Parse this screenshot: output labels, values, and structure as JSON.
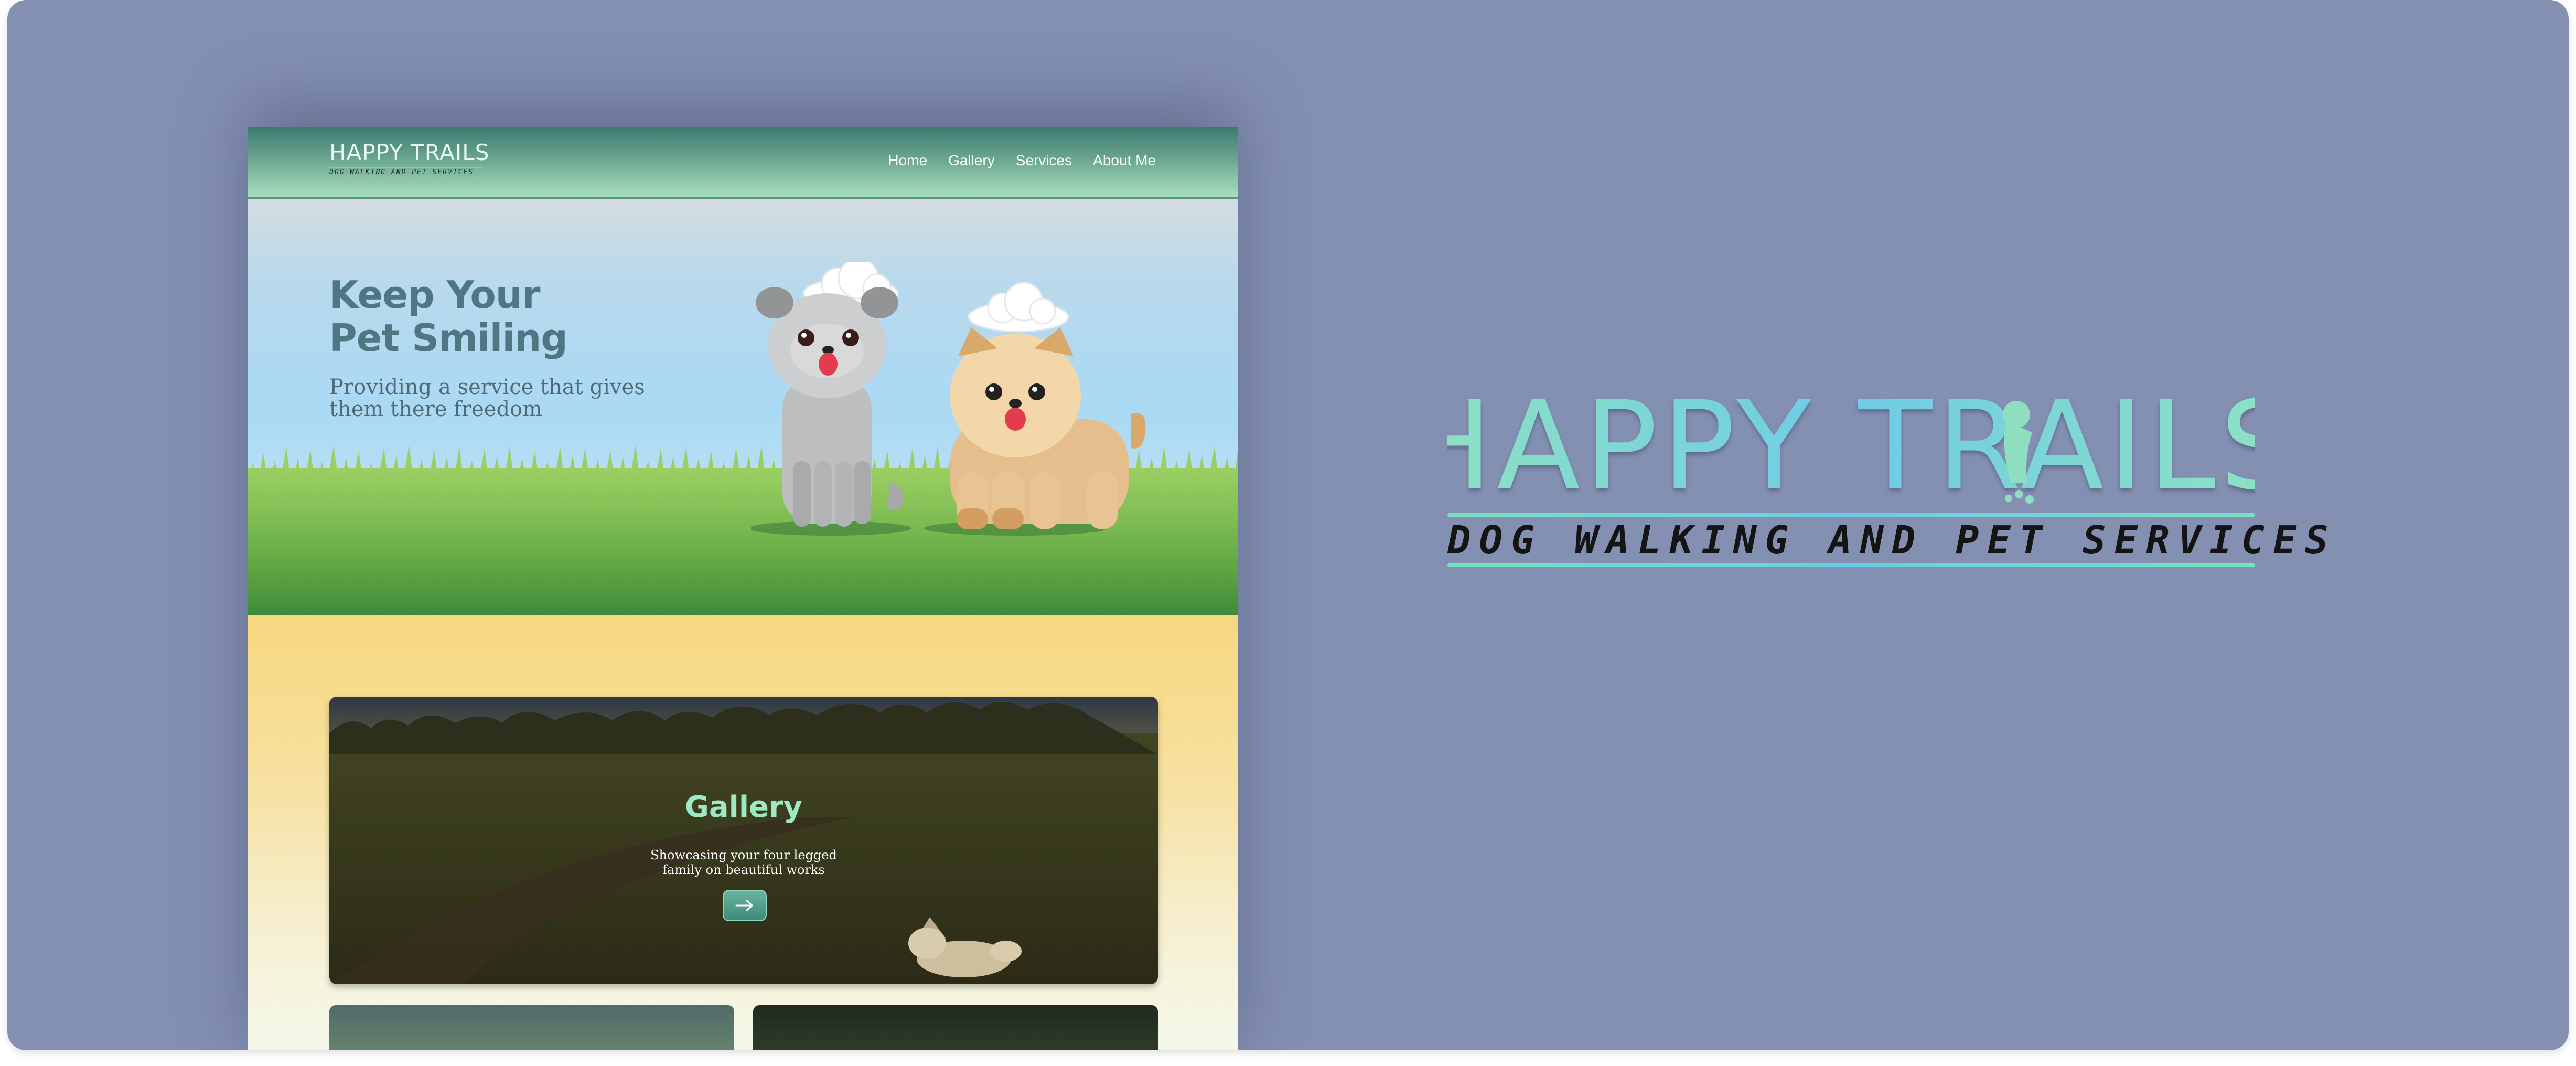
{
  "brand": {
    "name": "HAPPY TRAILS",
    "tagline": "DOG WALKING AND PET SERVICES",
    "colors": {
      "mint": "#8fe3c0",
      "sky": "#6ecbe6",
      "teal": "#4e7683",
      "background": "#8490b2"
    }
  },
  "site": {
    "header": {
      "logo_text": "HAPPY TRAILS",
      "logo_tagline": "DOG WALKING AND PET SERVICES",
      "nav": [
        "Home",
        "Gallery",
        "Services",
        "About Me"
      ]
    },
    "hero": {
      "title_line1": "Keep Your",
      "title_line2": "Pet Smiling",
      "subtitle": "Providing a service that gives them there freedom"
    },
    "gallery": {
      "title": "Gallery",
      "subtitle": "Showcasing your four legged family on beautiful works",
      "button_icon": "arrow-right-icon"
    }
  },
  "big_logo": {
    "name": "HAPPY TRAILS",
    "tagline": "DOG WALKING AND PET SERVICES"
  }
}
